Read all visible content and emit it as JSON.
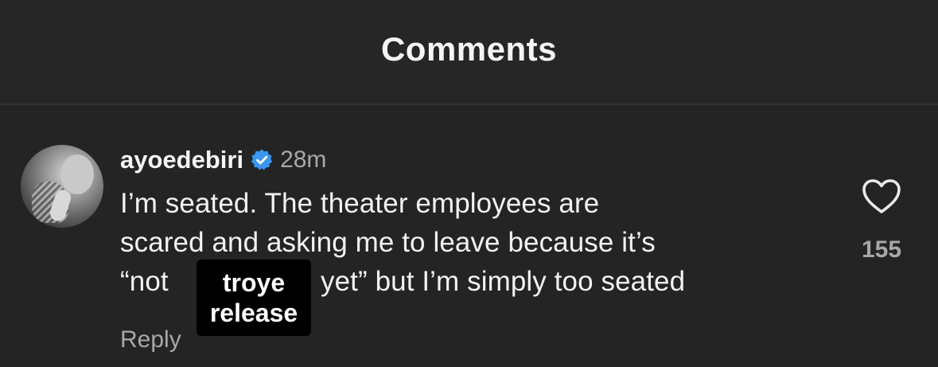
{
  "header": {
    "title": "Comments"
  },
  "comment": {
    "username": "ayoedebiri",
    "timestamp": "28m",
    "verified_icon": "verified-badge-icon",
    "verified_color": "#3897f0",
    "lines": [
      "I’m seated. The theater employees are",
      "scared and asking me to leave because it’s",
      "“not",
      "yet” but I’m simply too seated"
    ],
    "reply_label": "Reply",
    "like_icon": "heart-outline-icon",
    "like_count": "155"
  },
  "overlay": {
    "line1": "troye",
    "line2": "release"
  },
  "colors": {
    "background": "#262626",
    "text_primary": "#f2f2f2",
    "text_secondary": "#a8a8a8",
    "overlay_background": "#000000"
  }
}
